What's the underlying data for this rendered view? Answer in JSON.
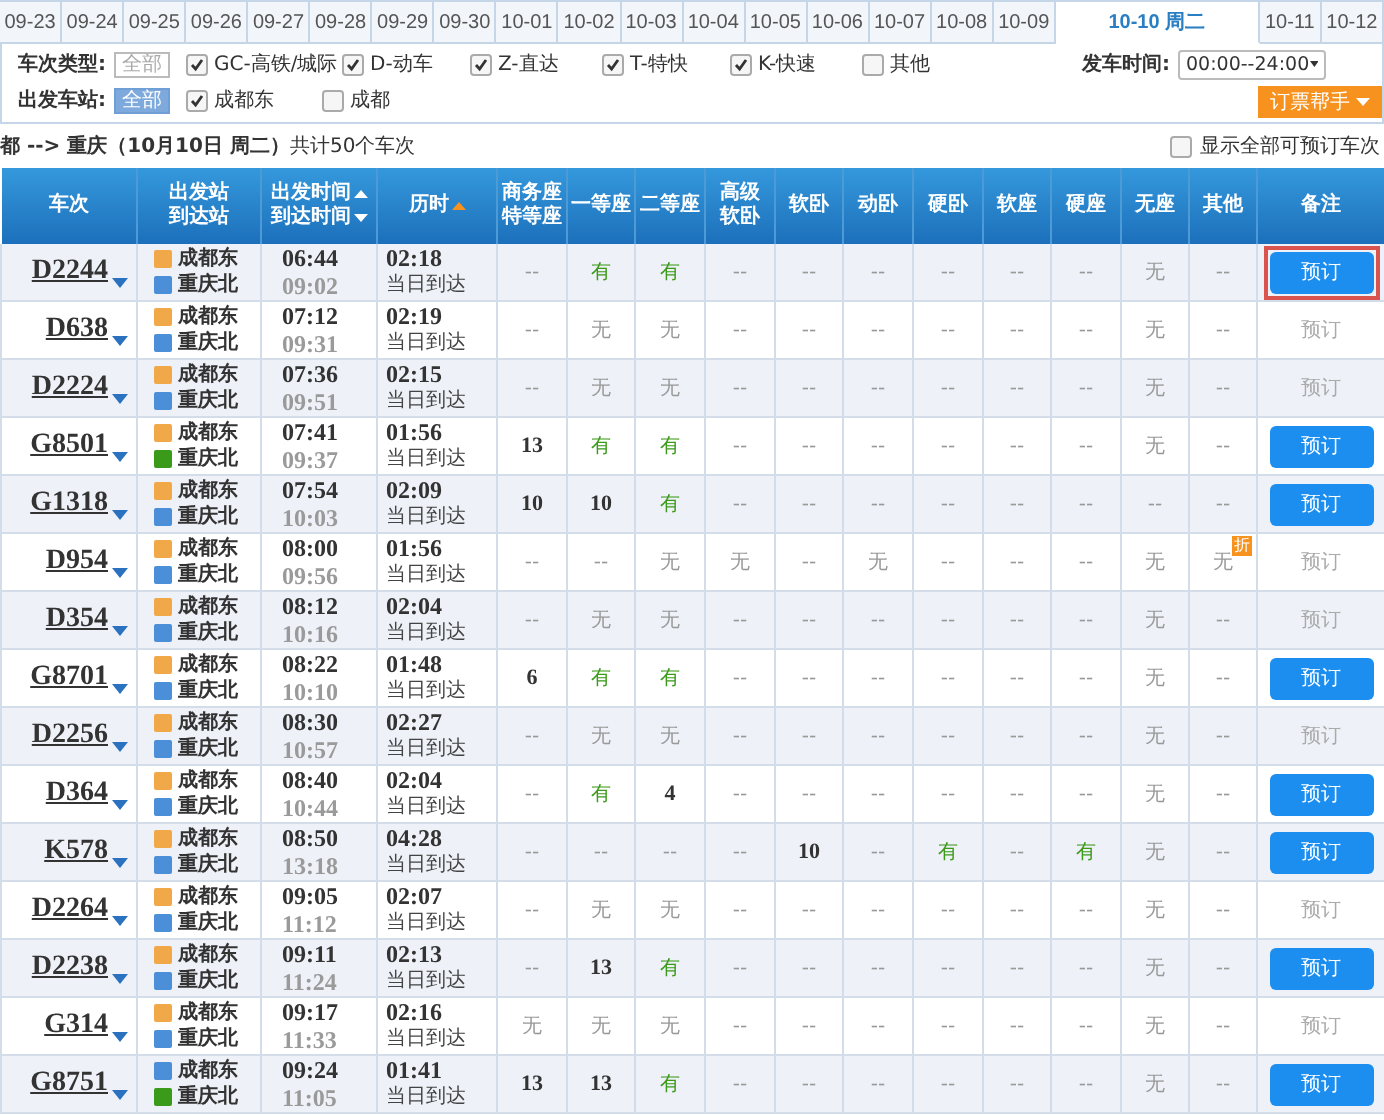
{
  "date_tabs": [
    {
      "label": "09-23",
      "selected": false
    },
    {
      "label": "09-24",
      "selected": false
    },
    {
      "label": "09-25",
      "selected": false
    },
    {
      "label": "09-26",
      "selected": false
    },
    {
      "label": "09-27",
      "selected": false
    },
    {
      "label": "09-28",
      "selected": false
    },
    {
      "label": "09-29",
      "selected": false
    },
    {
      "label": "09-30",
      "selected": false
    },
    {
      "label": "10-01",
      "selected": false
    },
    {
      "label": "10-02",
      "selected": false
    },
    {
      "label": "10-03",
      "selected": false
    },
    {
      "label": "10-04",
      "selected": false
    },
    {
      "label": "10-05",
      "selected": false
    },
    {
      "label": "10-06",
      "selected": false
    },
    {
      "label": "10-07",
      "selected": false
    },
    {
      "label": "10-08",
      "selected": false
    },
    {
      "label": "10-09",
      "selected": false
    },
    {
      "label": "10-10 周二",
      "selected": true
    },
    {
      "label": "10-11",
      "selected": false
    },
    {
      "label": "10-12",
      "selected": false
    }
  ],
  "filters": {
    "train_type": {
      "label": "车次类型:",
      "all": {
        "label": "全部",
        "selected": false
      },
      "options": [
        {
          "label": "GC-高铁/城际",
          "checked": true
        },
        {
          "label": "D-动车",
          "checked": true
        },
        {
          "label": "Z-直达",
          "checked": true
        },
        {
          "label": "T-特快",
          "checked": true
        },
        {
          "label": "K-快速",
          "checked": true
        },
        {
          "label": "其他",
          "checked": false
        }
      ]
    },
    "departure_time": {
      "label": "发车时间:",
      "value": "00:00--24:00"
    },
    "station": {
      "label": "出发车站:",
      "all": {
        "label": "全部",
        "selected": true
      },
      "options": [
        {
          "label": "成都东",
          "checked": true
        },
        {
          "label": "成都",
          "checked": false
        }
      ]
    },
    "helper_button": "订票帮手"
  },
  "summary": {
    "route": "**都 --> 重庆（10月10日 周二）**共计50个车次",
    "show_all": {
      "label": "显示全部可预订车次",
      "checked": false
    }
  },
  "table": {
    "columns": [
      {
        "lines": [
          "车次"
        ]
      },
      {
        "lines": [
          "出发站",
          "到达站"
        ]
      },
      {
        "lines": [
          "出发时间",
          "到达时间"
        ],
        "ascending": [
          true,
          false
        ],
        "active": false
      },
      {
        "lines": [
          "历时"
        ],
        "ascending": [
          true
        ],
        "active": true
      },
      {
        "lines": [
          "商务座",
          "特等座"
        ]
      },
      {
        "lines": [
          "一等座"
        ]
      },
      {
        "lines": [
          "二等座"
        ]
      },
      {
        "lines": [
          "高级",
          "软卧"
        ]
      },
      {
        "lines": [
          "软卧"
        ]
      },
      {
        "lines": [
          "动卧"
        ]
      },
      {
        "lines": [
          "硬卧"
        ]
      },
      {
        "lines": [
          "软座"
        ]
      },
      {
        "lines": [
          "硬座"
        ]
      },
      {
        "lines": [
          "无座"
        ]
      },
      {
        "lines": [
          "其他"
        ]
      },
      {
        "lines": [
          "备注"
        ]
      }
    ],
    "rows": [
      {
        "train": "D2244",
        "from": {
          "name": "成都东",
          "kind": "start"
        },
        "to": {
          "name": "重庆北",
          "kind": "pass"
        },
        "depart": "06:44",
        "arrive": "09:02",
        "duration": "02:18",
        "arrival_day": "当日到达",
        "seats": [
          {
            "text": "--",
            "kind": "none"
          },
          {
            "text": "有",
            "kind": "yes"
          },
          {
            "text": "有",
            "kind": "yes"
          },
          {
            "text": "--",
            "kind": "none"
          },
          {
            "text": "--",
            "kind": "none"
          },
          {
            "text": "--",
            "kind": "none"
          },
          {
            "text": "--",
            "kind": "none"
          },
          {
            "text": "--",
            "kind": "none"
          },
          {
            "text": "--",
            "kind": "none"
          },
          {
            "text": "无",
            "kind": "none"
          },
          {
            "text": "--",
            "kind": "none"
          }
        ],
        "book": {
          "label": "预订",
          "bookable": true,
          "highlighted": true
        }
      },
      {
        "train": "D638",
        "from": {
          "name": "成都东",
          "kind": "start"
        },
        "to": {
          "name": "重庆北",
          "kind": "pass"
        },
        "depart": "07:12",
        "arrive": "09:31",
        "duration": "02:19",
        "arrival_day": "当日到达",
        "seats": [
          {
            "text": "--",
            "kind": "none"
          },
          {
            "text": "无",
            "kind": "none"
          },
          {
            "text": "无",
            "kind": "none"
          },
          {
            "text": "--",
            "kind": "none"
          },
          {
            "text": "--",
            "kind": "none"
          },
          {
            "text": "--",
            "kind": "none"
          },
          {
            "text": "--",
            "kind": "none"
          },
          {
            "text": "--",
            "kind": "none"
          },
          {
            "text": "--",
            "kind": "none"
          },
          {
            "text": "无",
            "kind": "none"
          },
          {
            "text": "--",
            "kind": "none"
          }
        ],
        "book": {
          "label": "预订",
          "bookable": false,
          "highlighted": false
        }
      },
      {
        "train": "D2224",
        "from": {
          "name": "成都东",
          "kind": "start"
        },
        "to": {
          "name": "重庆北",
          "kind": "pass"
        },
        "depart": "07:36",
        "arrive": "09:51",
        "duration": "02:15",
        "arrival_day": "当日到达",
        "seats": [
          {
            "text": "--",
            "kind": "none"
          },
          {
            "text": "无",
            "kind": "none"
          },
          {
            "text": "无",
            "kind": "none"
          },
          {
            "text": "--",
            "kind": "none"
          },
          {
            "text": "--",
            "kind": "none"
          },
          {
            "text": "--",
            "kind": "none"
          },
          {
            "text": "--",
            "kind": "none"
          },
          {
            "text": "--",
            "kind": "none"
          },
          {
            "text": "--",
            "kind": "none"
          },
          {
            "text": "无",
            "kind": "none"
          },
          {
            "text": "--",
            "kind": "none"
          }
        ],
        "book": {
          "label": "预订",
          "bookable": false,
          "highlighted": false
        }
      },
      {
        "train": "G8501",
        "from": {
          "name": "成都东",
          "kind": "start"
        },
        "to": {
          "name": "重庆北",
          "kind": "end"
        },
        "depart": "07:41",
        "arrive": "09:37",
        "duration": "01:56",
        "arrival_day": "当日到达",
        "seats": [
          {
            "text": "13",
            "kind": "count"
          },
          {
            "text": "有",
            "kind": "yes"
          },
          {
            "text": "有",
            "kind": "yes"
          },
          {
            "text": "--",
            "kind": "none"
          },
          {
            "text": "--",
            "kind": "none"
          },
          {
            "text": "--",
            "kind": "none"
          },
          {
            "text": "--",
            "kind": "none"
          },
          {
            "text": "--",
            "kind": "none"
          },
          {
            "text": "--",
            "kind": "none"
          },
          {
            "text": "无",
            "kind": "none"
          },
          {
            "text": "--",
            "kind": "none"
          }
        ],
        "book": {
          "label": "预订",
          "bookable": true,
          "highlighted": false
        }
      },
      {
        "train": "G1318",
        "from": {
          "name": "成都东",
          "kind": "start"
        },
        "to": {
          "name": "重庆北",
          "kind": "pass"
        },
        "depart": "07:54",
        "arrive": "10:03",
        "duration": "02:09",
        "arrival_day": "当日到达",
        "seats": [
          {
            "text": "10",
            "kind": "count"
          },
          {
            "text": "10",
            "kind": "count"
          },
          {
            "text": "有",
            "kind": "yes"
          },
          {
            "text": "--",
            "kind": "none"
          },
          {
            "text": "--",
            "kind": "none"
          },
          {
            "text": "--",
            "kind": "none"
          },
          {
            "text": "--",
            "kind": "none"
          },
          {
            "text": "--",
            "kind": "none"
          },
          {
            "text": "--",
            "kind": "none"
          },
          {
            "text": "--",
            "kind": "none"
          },
          {
            "text": "--",
            "kind": "none"
          }
        ],
        "book": {
          "label": "预订",
          "bookable": true,
          "highlighted": false
        }
      },
      {
        "train": "D954",
        "from": {
          "name": "成都东",
          "kind": "start"
        },
        "to": {
          "name": "重庆北",
          "kind": "pass"
        },
        "depart": "08:00",
        "arrive": "09:56",
        "duration": "01:56",
        "arrival_day": "当日到达",
        "seats": [
          {
            "text": "--",
            "kind": "none"
          },
          {
            "text": "--",
            "kind": "none"
          },
          {
            "text": "无",
            "kind": "none"
          },
          {
            "text": "无",
            "kind": "none"
          },
          {
            "text": "--",
            "kind": "none"
          },
          {
            "text": "无",
            "kind": "none"
          },
          {
            "text": "--",
            "kind": "none"
          },
          {
            "text": "--",
            "kind": "none"
          },
          {
            "text": "--",
            "kind": "none"
          },
          {
            "text": "无",
            "kind": "none"
          },
          {
            "text": "无",
            "kind": "none",
            "badge": "折"
          }
        ],
        "book": {
          "label": "预订",
          "bookable": false,
          "highlighted": false
        }
      },
      {
        "train": "D354",
        "from": {
          "name": "成都东",
          "kind": "start"
        },
        "to": {
          "name": "重庆北",
          "kind": "pass"
        },
        "depart": "08:12",
        "arrive": "10:16",
        "duration": "02:04",
        "arrival_day": "当日到达",
        "seats": [
          {
            "text": "--",
            "kind": "none"
          },
          {
            "text": "无",
            "kind": "none"
          },
          {
            "text": "无",
            "kind": "none"
          },
          {
            "text": "--",
            "kind": "none"
          },
          {
            "text": "--",
            "kind": "none"
          },
          {
            "text": "--",
            "kind": "none"
          },
          {
            "text": "--",
            "kind": "none"
          },
          {
            "text": "--",
            "kind": "none"
          },
          {
            "text": "--",
            "kind": "none"
          },
          {
            "text": "无",
            "kind": "none"
          },
          {
            "text": "--",
            "kind": "none"
          }
        ],
        "book": {
          "label": "预订",
          "bookable": false,
          "highlighted": false
        }
      },
      {
        "train": "G8701",
        "from": {
          "name": "成都东",
          "kind": "start"
        },
        "to": {
          "name": "重庆北",
          "kind": "pass"
        },
        "depart": "08:22",
        "arrive": "10:10",
        "duration": "01:48",
        "arrival_day": "当日到达",
        "seats": [
          {
            "text": "6",
            "kind": "count"
          },
          {
            "text": "有",
            "kind": "yes"
          },
          {
            "text": "有",
            "kind": "yes"
          },
          {
            "text": "--",
            "kind": "none"
          },
          {
            "text": "--",
            "kind": "none"
          },
          {
            "text": "--",
            "kind": "none"
          },
          {
            "text": "--",
            "kind": "none"
          },
          {
            "text": "--",
            "kind": "none"
          },
          {
            "text": "--",
            "kind": "none"
          },
          {
            "text": "无",
            "kind": "none"
          },
          {
            "text": "--",
            "kind": "none"
          }
        ],
        "book": {
          "label": "预订",
          "bookable": true,
          "highlighted": false
        }
      },
      {
        "train": "D2256",
        "from": {
          "name": "成都东",
          "kind": "start"
        },
        "to": {
          "name": "重庆北",
          "kind": "pass"
        },
        "depart": "08:30",
        "arrive": "10:57",
        "duration": "02:27",
        "arrival_day": "当日到达",
        "seats": [
          {
            "text": "--",
            "kind": "none"
          },
          {
            "text": "无",
            "kind": "none"
          },
          {
            "text": "无",
            "kind": "none"
          },
          {
            "text": "--",
            "kind": "none"
          },
          {
            "text": "--",
            "kind": "none"
          },
          {
            "text": "--",
            "kind": "none"
          },
          {
            "text": "--",
            "kind": "none"
          },
          {
            "text": "--",
            "kind": "none"
          },
          {
            "text": "--",
            "kind": "none"
          },
          {
            "text": "无",
            "kind": "none"
          },
          {
            "text": "--",
            "kind": "none"
          }
        ],
        "book": {
          "label": "预订",
          "bookable": false,
          "highlighted": false
        }
      },
      {
        "train": "D364",
        "from": {
          "name": "成都东",
          "kind": "start"
        },
        "to": {
          "name": "重庆北",
          "kind": "pass"
        },
        "depart": "08:40",
        "arrive": "10:44",
        "duration": "02:04",
        "arrival_day": "当日到达",
        "seats": [
          {
            "text": "--",
            "kind": "none"
          },
          {
            "text": "有",
            "kind": "yes"
          },
          {
            "text": "4",
            "kind": "count"
          },
          {
            "text": "--",
            "kind": "none"
          },
          {
            "text": "--",
            "kind": "none"
          },
          {
            "text": "--",
            "kind": "none"
          },
          {
            "text": "--",
            "kind": "none"
          },
          {
            "text": "--",
            "kind": "none"
          },
          {
            "text": "--",
            "kind": "none"
          },
          {
            "text": "无",
            "kind": "none"
          },
          {
            "text": "--",
            "kind": "none"
          }
        ],
        "book": {
          "label": "预订",
          "bookable": true,
          "highlighted": false
        }
      },
      {
        "train": "K578",
        "from": {
          "name": "成都东",
          "kind": "start"
        },
        "to": {
          "name": "重庆北",
          "kind": "pass"
        },
        "depart": "08:50",
        "arrive": "13:18",
        "duration": "04:28",
        "arrival_day": "当日到达",
        "seats": [
          {
            "text": "--",
            "kind": "none"
          },
          {
            "text": "--",
            "kind": "none"
          },
          {
            "text": "--",
            "kind": "none"
          },
          {
            "text": "--",
            "kind": "none"
          },
          {
            "text": "10",
            "kind": "count"
          },
          {
            "text": "--",
            "kind": "none"
          },
          {
            "text": "有",
            "kind": "yes"
          },
          {
            "text": "--",
            "kind": "none"
          },
          {
            "text": "有",
            "kind": "yes"
          },
          {
            "text": "无",
            "kind": "none"
          },
          {
            "text": "--",
            "kind": "none"
          }
        ],
        "book": {
          "label": "预订",
          "bookable": true,
          "highlighted": false
        }
      },
      {
        "train": "D2264",
        "from": {
          "name": "成都东",
          "kind": "start"
        },
        "to": {
          "name": "重庆北",
          "kind": "pass"
        },
        "depart": "09:05",
        "arrive": "11:12",
        "duration": "02:07",
        "arrival_day": "当日到达",
        "seats": [
          {
            "text": "--",
            "kind": "none"
          },
          {
            "text": "无",
            "kind": "none"
          },
          {
            "text": "无",
            "kind": "none"
          },
          {
            "text": "--",
            "kind": "none"
          },
          {
            "text": "--",
            "kind": "none"
          },
          {
            "text": "--",
            "kind": "none"
          },
          {
            "text": "--",
            "kind": "none"
          },
          {
            "text": "--",
            "kind": "none"
          },
          {
            "text": "--",
            "kind": "none"
          },
          {
            "text": "无",
            "kind": "none"
          },
          {
            "text": "--",
            "kind": "none"
          }
        ],
        "book": {
          "label": "预订",
          "bookable": false,
          "highlighted": false
        }
      },
      {
        "train": "D2238",
        "from": {
          "name": "成都东",
          "kind": "start"
        },
        "to": {
          "name": "重庆北",
          "kind": "pass"
        },
        "depart": "09:11",
        "arrive": "11:24",
        "duration": "02:13",
        "arrival_day": "当日到达",
        "seats": [
          {
            "text": "--",
            "kind": "none"
          },
          {
            "text": "13",
            "kind": "count"
          },
          {
            "text": "有",
            "kind": "yes"
          },
          {
            "text": "--",
            "kind": "none"
          },
          {
            "text": "--",
            "kind": "none"
          },
          {
            "text": "--",
            "kind": "none"
          },
          {
            "text": "--",
            "kind": "none"
          },
          {
            "text": "--",
            "kind": "none"
          },
          {
            "text": "--",
            "kind": "none"
          },
          {
            "text": "无",
            "kind": "none"
          },
          {
            "text": "--",
            "kind": "none"
          }
        ],
        "book": {
          "label": "预订",
          "bookable": true,
          "highlighted": false
        }
      },
      {
        "train": "G314",
        "from": {
          "name": "成都东",
          "kind": "start"
        },
        "to": {
          "name": "重庆北",
          "kind": "pass"
        },
        "depart": "09:17",
        "arrive": "11:33",
        "duration": "02:16",
        "arrival_day": "当日到达",
        "seats": [
          {
            "text": "无",
            "kind": "none"
          },
          {
            "text": "无",
            "kind": "none"
          },
          {
            "text": "无",
            "kind": "none"
          },
          {
            "text": "--",
            "kind": "none"
          },
          {
            "text": "--",
            "kind": "none"
          },
          {
            "text": "--",
            "kind": "none"
          },
          {
            "text": "--",
            "kind": "none"
          },
          {
            "text": "--",
            "kind": "none"
          },
          {
            "text": "--",
            "kind": "none"
          },
          {
            "text": "无",
            "kind": "none"
          },
          {
            "text": "--",
            "kind": "none"
          }
        ],
        "book": {
          "label": "预订",
          "bookable": false,
          "highlighted": false
        }
      },
      {
        "train": "G8751",
        "from": {
          "name": "成都东",
          "kind": "pass"
        },
        "to": {
          "name": "重庆北",
          "kind": "end"
        },
        "depart": "09:24",
        "arrive": "11:05",
        "duration": "01:41",
        "arrival_day": "当日到达",
        "seats": [
          {
            "text": "13",
            "kind": "count"
          },
          {
            "text": "13",
            "kind": "count"
          },
          {
            "text": "有",
            "kind": "yes"
          },
          {
            "text": "--",
            "kind": "none"
          },
          {
            "text": "--",
            "kind": "none"
          },
          {
            "text": "--",
            "kind": "none"
          },
          {
            "text": "--",
            "kind": "none"
          },
          {
            "text": "--",
            "kind": "none"
          },
          {
            "text": "--",
            "kind": "none"
          },
          {
            "text": "无",
            "kind": "none"
          },
          {
            "text": "--",
            "kind": "none"
          }
        ],
        "book": {
          "label": "预订",
          "bookable": true,
          "highlighted": false
        }
      }
    ]
  }
}
